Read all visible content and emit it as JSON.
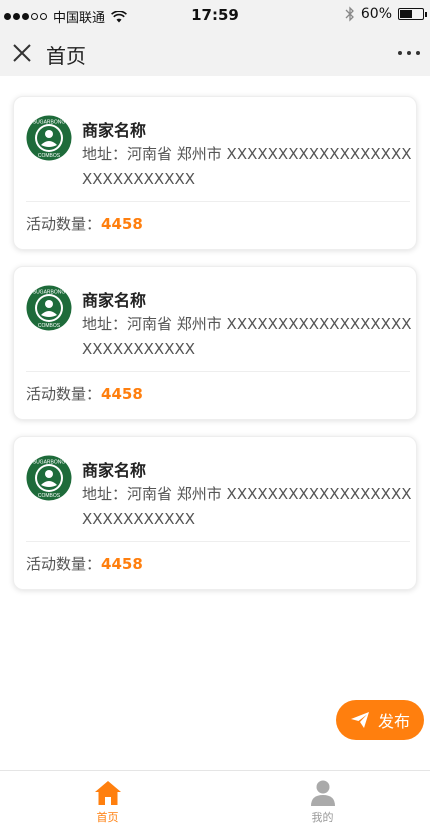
{
  "status_bar": {
    "carrier": "中国联通",
    "time": "17:59",
    "battery": "60%",
    "battery_level": 0.6
  },
  "nav": {
    "title": "首页",
    "close_icon": "close-icon",
    "more_icon": "more-dots-icon"
  },
  "merchants": [
    {
      "name": "商家名称",
      "address": "地址：河南省 郑州市 XXXXXXXXXXXXXXXXXXXXXXXXXXXXX",
      "activity_label": "活动数量：",
      "activity_count": "4458",
      "logo_text_top": "SUGARBONG",
      "logo_text_bottom": "COMBOS"
    },
    {
      "name": "商家名称",
      "address": "地址：河南省 郑州市 XXXXXXXXXXXXXXXXXXXXXXXXXXXXX",
      "activity_label": "活动数量：",
      "activity_count": "4458",
      "logo_text_top": "SUGARBONG",
      "logo_text_bottom": "COMBOS"
    },
    {
      "name": "商家名称",
      "address": "地址：河南省 郑州市 XXXXXXXXXXXXXXXXXXXXXXXXXXXXX",
      "activity_label": "活动数量：",
      "activity_count": "4458",
      "logo_text_top": "SUGARBONG",
      "logo_text_bottom": "COMBOS"
    }
  ],
  "publish_button": {
    "label": "发布",
    "icon": "send-icon"
  },
  "tabs": [
    {
      "label": "首页",
      "icon": "home-icon",
      "active": true
    },
    {
      "label": "我的",
      "icon": "user-icon",
      "active": false
    }
  ],
  "colors": {
    "accent": "#ff7f0e",
    "logo_green": "#1e6b3a"
  }
}
